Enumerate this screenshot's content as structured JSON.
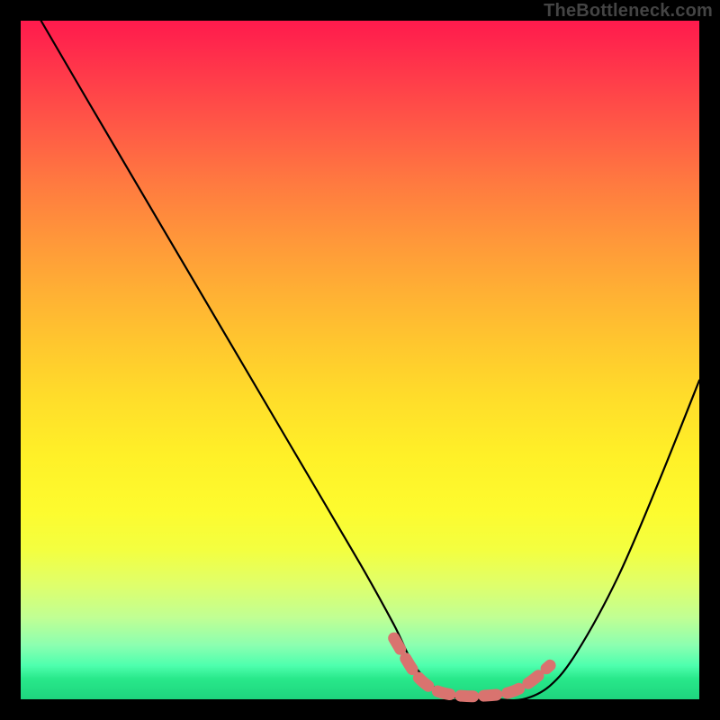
{
  "watermark": "TheBottleneck.com",
  "chart_data": {
    "type": "line",
    "title": "",
    "xlabel": "",
    "ylabel": "",
    "xlim": [
      0,
      100
    ],
    "ylim": [
      0,
      100
    ],
    "grid": false,
    "legend": false,
    "background_gradient": [
      "#ff1a4d",
      "#ffde2a",
      "#1ed47e"
    ],
    "series": [
      {
        "name": "bottleneck-curve",
        "color": "#000000",
        "x": [
          3,
          10,
          20,
          30,
          40,
          50,
          55,
          58,
          62,
          66,
          70,
          74,
          78,
          82,
          88,
          94,
          100
        ],
        "y": [
          100,
          88,
          71,
          54,
          37,
          20,
          11,
          5,
          1,
          0,
          0,
          0,
          2,
          7,
          18,
          32,
          47
        ]
      }
    ],
    "highlight": {
      "name": "valley-highlight",
      "color": "#d9736f",
      "x": [
        55,
        58,
        60,
        62,
        65,
        68,
        72,
        75,
        78
      ],
      "y": [
        9,
        4,
        2,
        1,
        0.5,
        0.5,
        1,
        2.5,
        5
      ]
    }
  }
}
